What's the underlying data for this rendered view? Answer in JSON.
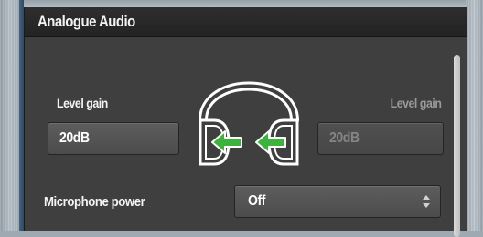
{
  "panel": {
    "title": "Analogue Audio"
  },
  "left_gain": {
    "label": "Level gain",
    "value": "20dB"
  },
  "right_gain": {
    "label": "Level gain",
    "value": "20dB"
  },
  "microphone_power": {
    "label": "Microphone power",
    "value": "Off"
  },
  "icons": {
    "headphones": "headphones-icon",
    "arrows": "arrow-left-icon",
    "select": "select-arrows-icon"
  },
  "colors": {
    "arrow_green": "#3db33d"
  }
}
